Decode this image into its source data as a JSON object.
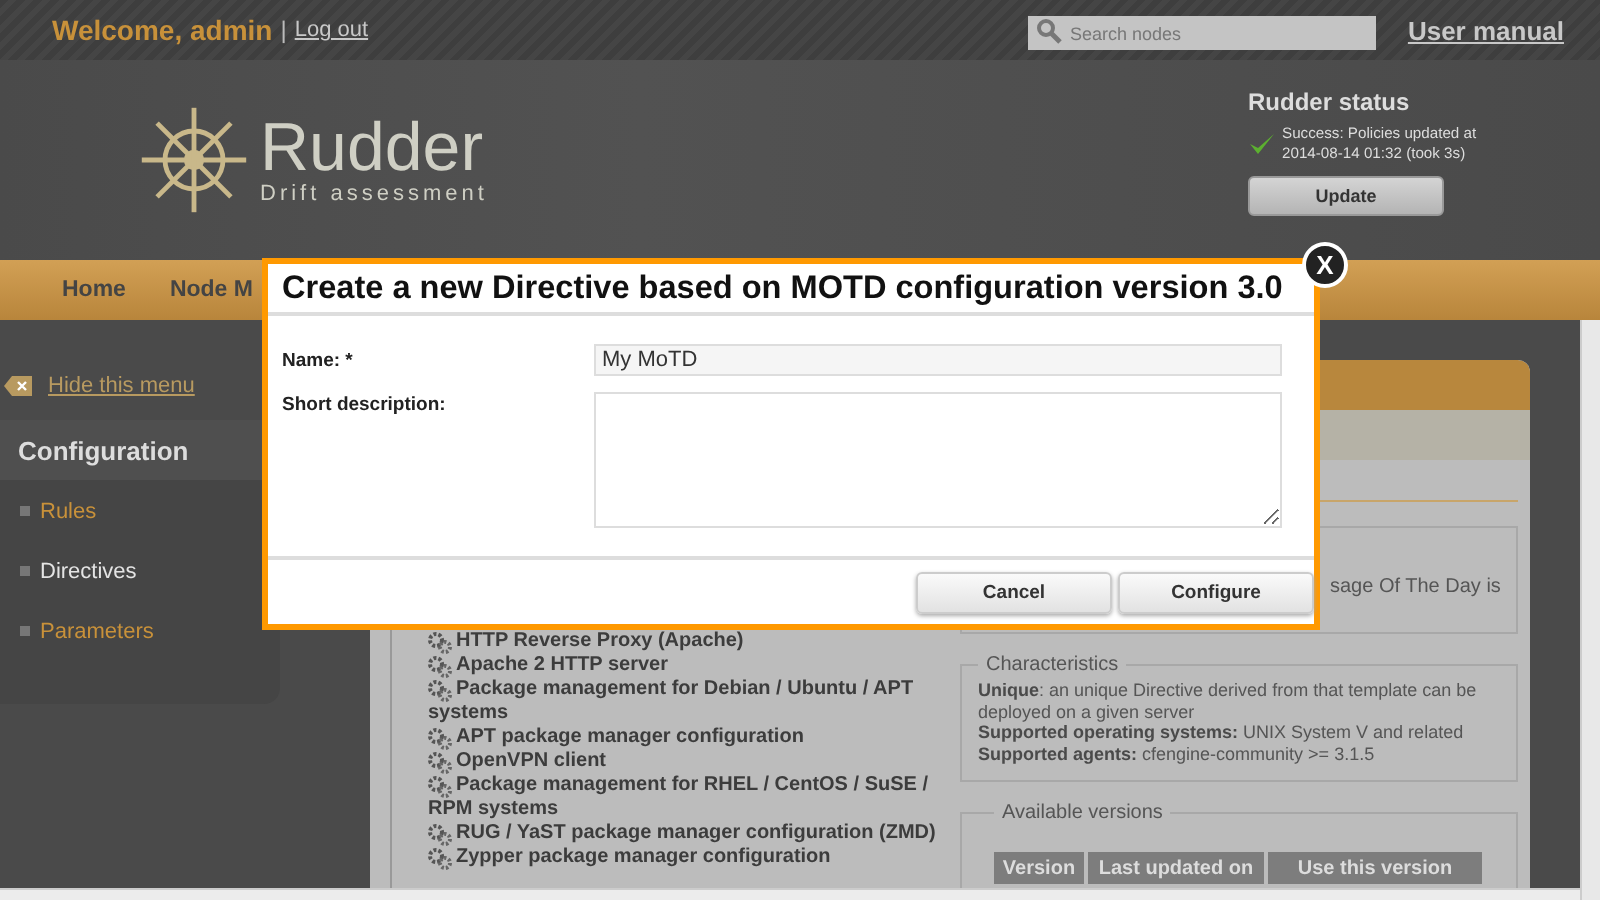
{
  "top_bar": {
    "welcome": "Welcome, admin",
    "separator": "|",
    "logout": "Log out",
    "search": {
      "placeholder": "Search nodes"
    },
    "user_manual": "User manual"
  },
  "header": {
    "logo_name": "Rudder",
    "logo_tagline": "Drift assessment",
    "status": {
      "title": "Rudder status",
      "message": "Success: Policies updated at 2014-08-14 01:32 (took 3s)",
      "button": "Update"
    }
  },
  "nav": [
    {
      "label": "Home"
    },
    {
      "label": "Node M"
    }
  ],
  "sidebar": {
    "hide_link": "Hide this menu",
    "title": "Configuration",
    "items": [
      {
        "label": "Rules",
        "selected": false
      },
      {
        "label": "Directives",
        "selected": true
      },
      {
        "label": "Parameters",
        "selected": false
      }
    ]
  },
  "technique_tree": [
    "HTTP Reverse Proxy (Apache)",
    "Apache 2 HTTP server",
    "Package management for Debian / Ubuntu / APT systems",
    "APT package manager configuration",
    "OpenVPN client",
    "Package management for RHEL / CentOS / SuSE / RPM systems",
    "RUG / YaST package manager configuration (ZMD)",
    "Zypper package manager configuration"
  ],
  "description_fragment": "sage Of The Day is",
  "characteristics": {
    "legend": "Characteristics",
    "lines": [
      "**Unique**: an unique Directive derived from that template can be deployed on a given server",
      "**Supported operating systems:** UNIX System V and related",
      "**Supported agents:** cfengine-community >= 3.1.5"
    ]
  },
  "versions": {
    "legend": "Available versions",
    "columns": [
      "Version",
      "Last updated on",
      "Use this version"
    ]
  },
  "dialog": {
    "title": "Create a new Directive based on MOTD configuration version 3.0",
    "close": "X",
    "fields": [
      {
        "label": "Name: *",
        "kind": "input",
        "value": "My MoTD"
      },
      {
        "label": "Short description:",
        "kind": "textarea"
      }
    ],
    "buttons": [
      "Cancel",
      "Configure"
    ]
  }
}
